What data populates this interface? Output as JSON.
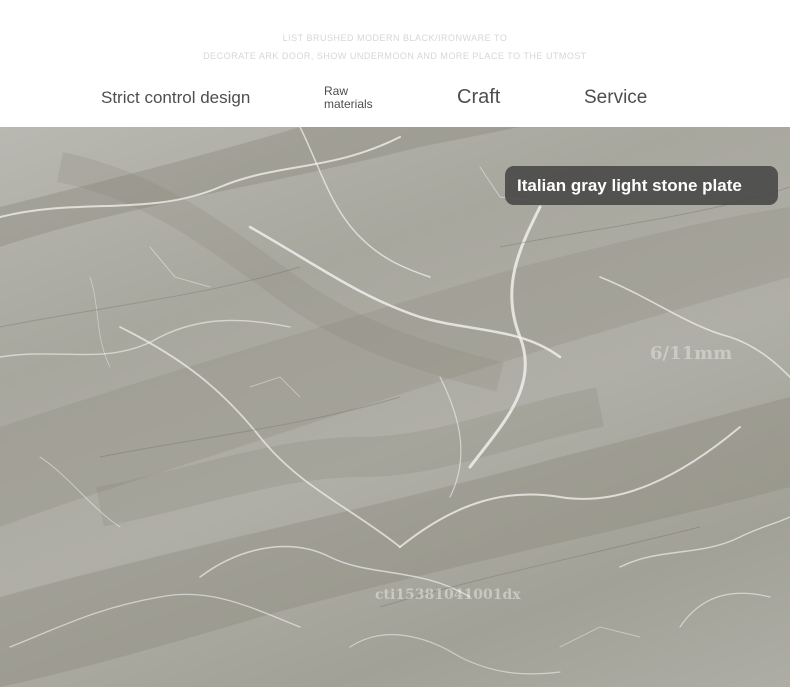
{
  "header": {
    "faint_line_1": "LIST BRUSHED MODERN BLACK/IRONWARE TO",
    "faint_line_2": "DECORATE ARK DOOR, SHOW UNDERMOON AND MORE PLACE TO THE UTMOST",
    "nav": {
      "strict": "Strict control design",
      "raw": "Raw materials",
      "craft": "Craft",
      "service": "Service"
    }
  },
  "product": {
    "label": "Italian gray light stone plate",
    "thickness_watermark": "6/11mm",
    "store_watermark": "cti15381041001dx"
  },
  "colors": {
    "stone_base": "#b0afa7",
    "label_bg": "#464646",
    "nav_text": "#4e4e4e"
  }
}
